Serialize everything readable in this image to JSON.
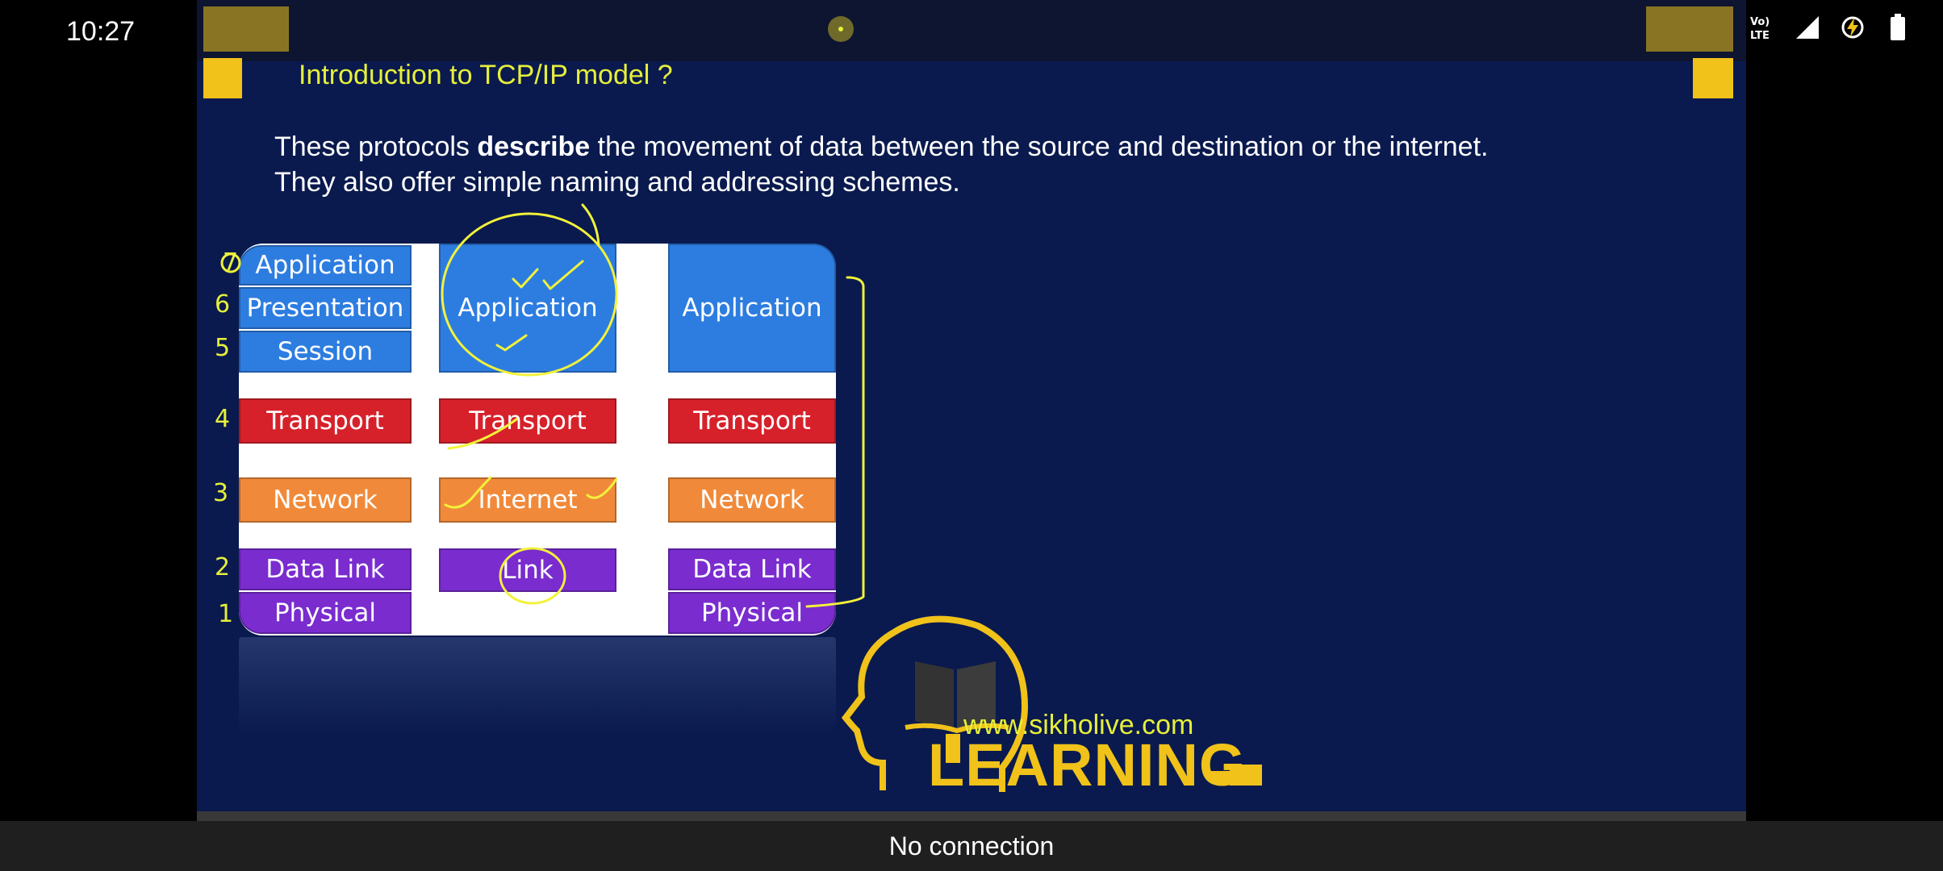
{
  "status_bar": {
    "time": "10:27",
    "icons": [
      "headphones-icon",
      "volte-icon",
      "signal-icon",
      "battery-saver-icon",
      "battery-icon"
    ],
    "volte_label": "Vo) LTE"
  },
  "slide": {
    "title": "Introduction to TCP/IP model ?",
    "description_pre": "These protocols ",
    "description_bold": "describe",
    "description_post": " the movement of data between the source and destination or the internet.",
    "description_line2": "They also offer simple naming and addressing schemes.",
    "colors": {
      "background": "#0a1a4e",
      "title": "#e6ef3a",
      "accent": "#f0c21a"
    }
  },
  "diagram": {
    "osi": {
      "application": "Application",
      "presentation": "Presentation",
      "session": "Session",
      "transport": "Transport",
      "network": "Network",
      "data_link": "Data Link",
      "physical": "Physical"
    },
    "tcpip": {
      "application": "Application",
      "transport": "Transport",
      "internet": "Internet",
      "link": "Link"
    },
    "hybrid": {
      "application": "Application",
      "transport": "Transport",
      "network": "Network",
      "data_link": "Data Link",
      "physical": "Physical"
    },
    "annotations": {
      "n7": "7",
      "n6": "6",
      "n5": "5",
      "n4": "4",
      "n3": "3",
      "n2": "2",
      "n1": "1"
    },
    "colors": {
      "application": "#2d7de0",
      "transport": "#d6212b",
      "network": "#f08a3a",
      "link": "#7a2ccf",
      "pen": "#f2f23a"
    }
  },
  "branding": {
    "url": "www.sikholive.com",
    "word": "LEARNING"
  },
  "toast": {
    "message": "No connection"
  }
}
